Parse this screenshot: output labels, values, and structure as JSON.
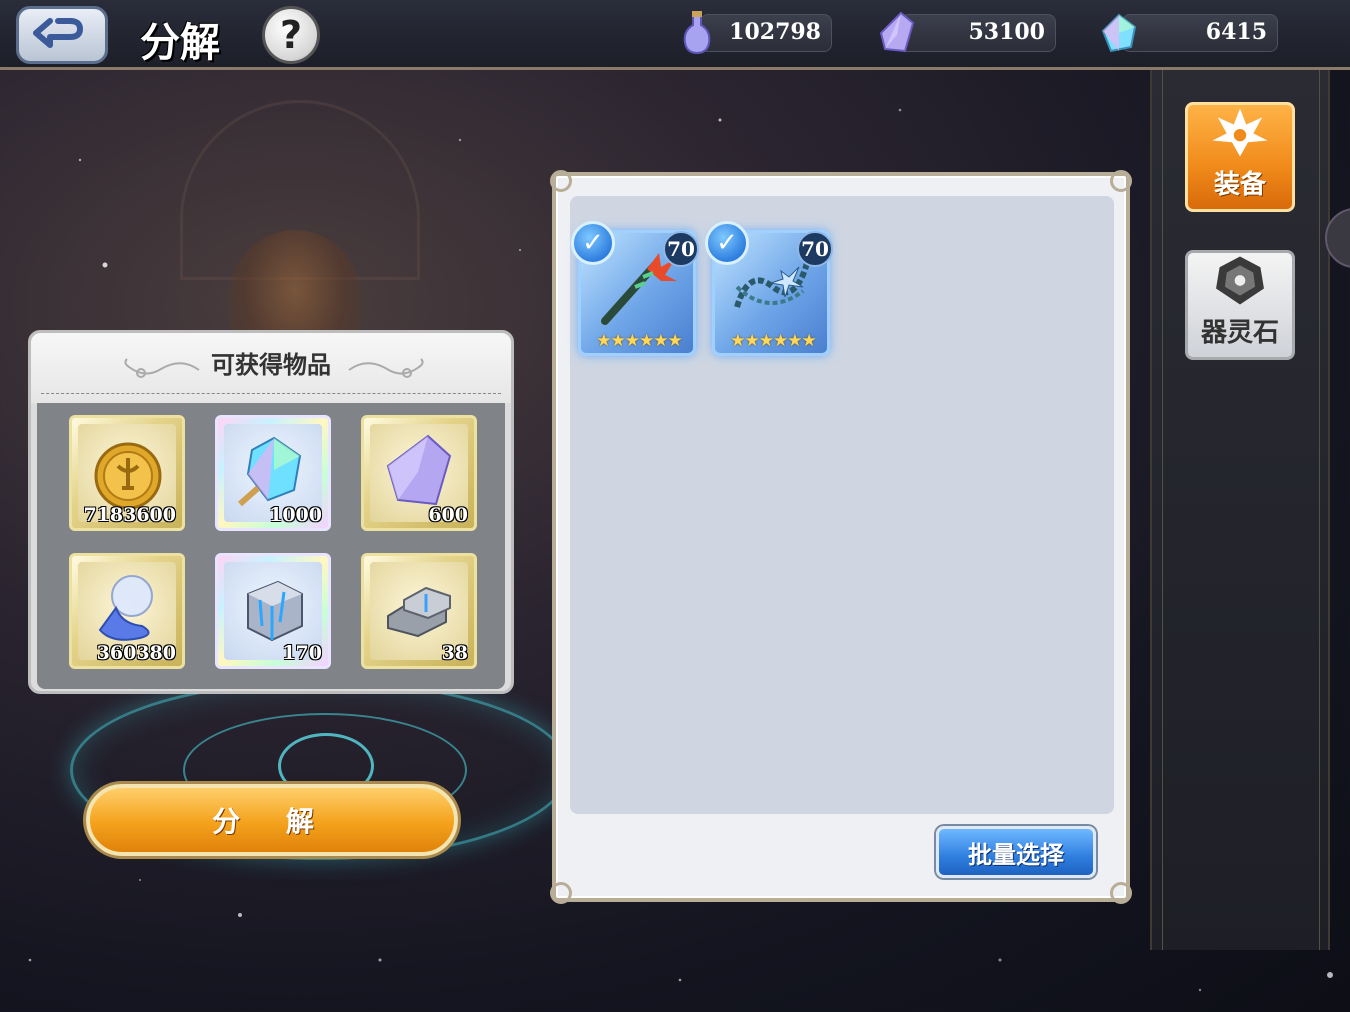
{
  "header": {
    "title": "分解",
    "help_label": "?"
  },
  "currencies": [
    {
      "icon": "potion-bottle-icon",
      "value": "102798"
    },
    {
      "icon": "purple-crystal-icon",
      "value": "53100"
    },
    {
      "icon": "rainbow-gem-icon",
      "value": "6415"
    }
  ],
  "side_tabs": [
    {
      "label": "装备",
      "icon": "equipment-lily-icon",
      "active": true
    },
    {
      "label": "器灵石",
      "icon": "spirit-stone-icon",
      "active": false
    }
  ],
  "rewards": {
    "title": "可获得物品",
    "items": [
      {
        "icon": "gold-coin-icon",
        "qty": "7183600",
        "frame": "gold"
      },
      {
        "icon": "rainbow-gem-icon",
        "qty": "1000",
        "frame": "rainbow"
      },
      {
        "icon": "purple-crystal-icon",
        "qty": "600",
        "frame": "gold"
      },
      {
        "icon": "spilled-potion-icon",
        "qty": "360380",
        "frame": "gold"
      },
      {
        "icon": "blue-ore-block-icon",
        "qty": "170",
        "frame": "rainbow"
      },
      {
        "icon": "silver-ingot-icon",
        "qty": "38",
        "frame": "gold"
      }
    ]
  },
  "decompose_button": "分 解",
  "equipment": {
    "items": [
      {
        "icon": "flame-scepter-icon",
        "level": "70",
        "stars": "★★★★★★",
        "selected": true
      },
      {
        "icon": "chain-whip-icon",
        "level": "70",
        "stars": "★★★★★★",
        "selected": true
      }
    ],
    "batch_select_label": "批量选择"
  },
  "colors": {
    "accent_orange": "#f4a21c",
    "accent_blue": "#2f7fe0",
    "panel_light": "#eef0f4"
  }
}
